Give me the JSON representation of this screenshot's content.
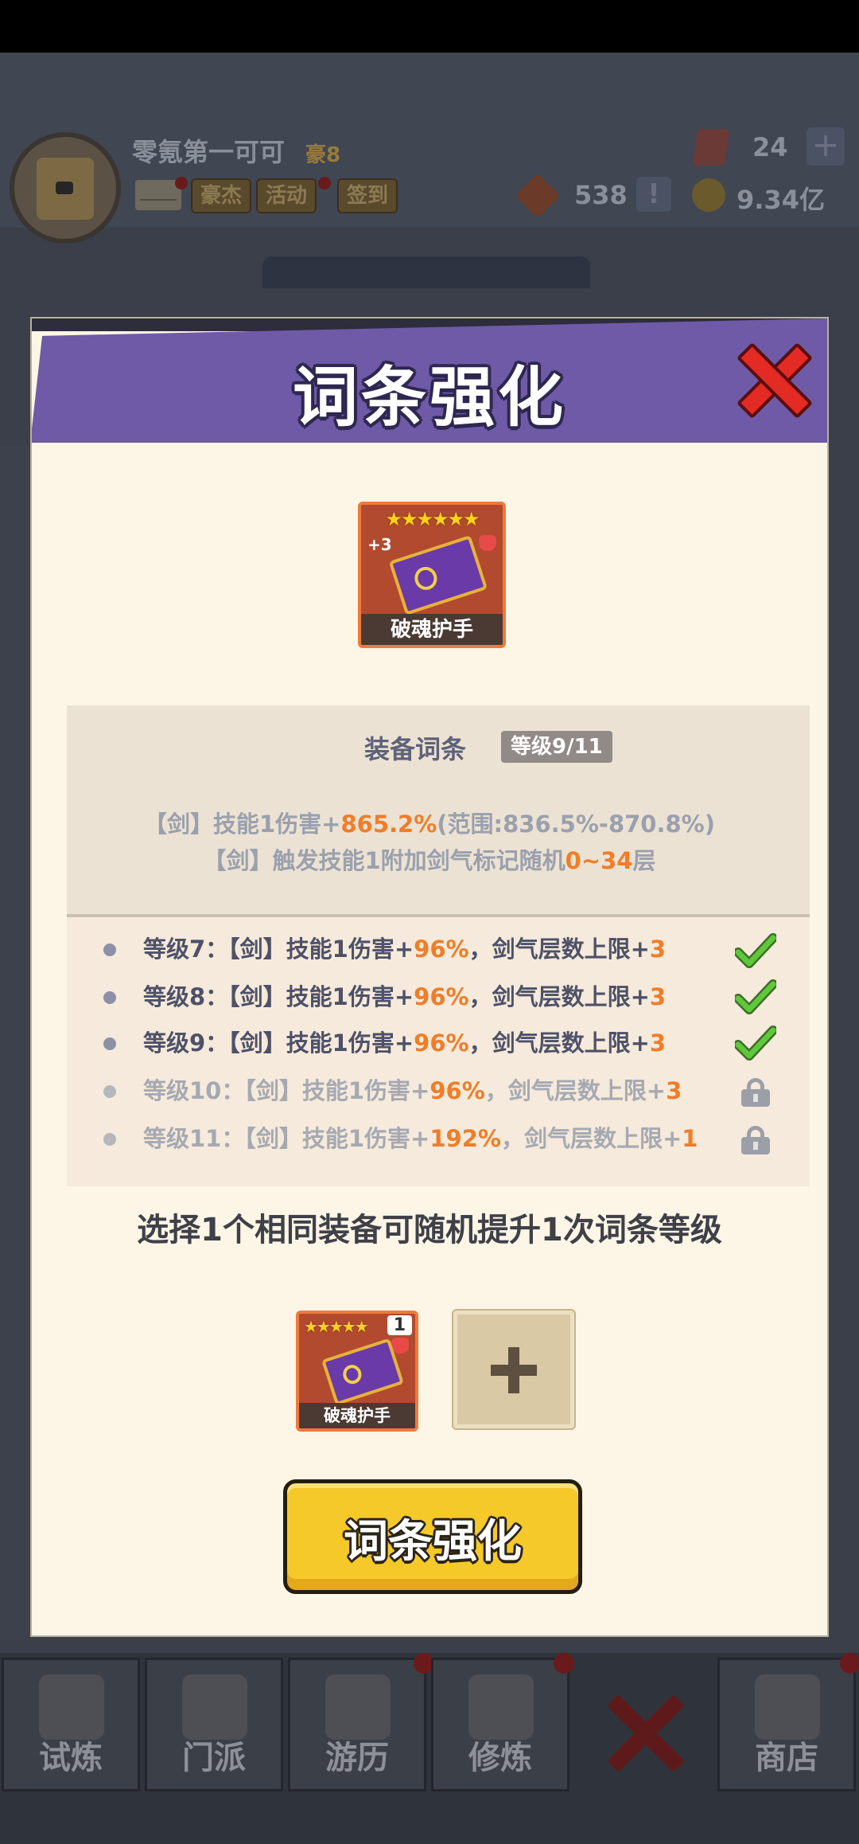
{
  "header": {
    "player_name": "零氪第一可可",
    "rank_label": "豪8",
    "buttons": [
      "豪杰",
      "活动",
      "签到"
    ],
    "gems": "24",
    "tokens": "538",
    "gold": "9.34亿"
  },
  "modal": {
    "title": "词条强化",
    "equipment": {
      "name": "破魂护手",
      "stars": "★★★★★★",
      "plus": "+3"
    },
    "affix_panel": {
      "title": "装备词条",
      "level_badge": "等级9/11",
      "line1_prefix": "【剑】技能1伤害+",
      "line1_value": "865.2%",
      "line1_suffix": "(范围:836.5%-870.8%)",
      "line2_prefix": "【剑】触发技能1附加剑气标记随机",
      "line2_value": "0~34",
      "line2_suffix": "层"
    },
    "levels": [
      {
        "label": "等级7：【剑】技能1伤害+",
        "bonus": "96%",
        "mid": "，剑气层数上限+",
        "cap": "3",
        "unlocked": true
      },
      {
        "label": "等级8：【剑】技能1伤害+",
        "bonus": "96%",
        "mid": "，剑气层数上限+",
        "cap": "3",
        "unlocked": true
      },
      {
        "label": "等级9：【剑】技能1伤害+",
        "bonus": "96%",
        "mid": "，剑气层数上限+",
        "cap": "3",
        "unlocked": true
      },
      {
        "label": "等级10：【剑】技能1伤害+",
        "bonus": "96%",
        "mid": "，剑气层数上限+",
        "cap": "3",
        "unlocked": false
      },
      {
        "label": "等级11：【剑】技能1伤害+",
        "bonus": "192%",
        "mid": "，剑气层数上限+",
        "cap": "1",
        "unlocked": false
      }
    ],
    "hint": "选择1个相同装备可随机提升1次词条等级",
    "material": {
      "name": "破魂护手",
      "stars": "★★★★★",
      "count": "1"
    },
    "action_label": "词条强化"
  },
  "bottom_nav": [
    "试炼",
    "门派",
    "游历",
    "修炼",
    "商店"
  ],
  "colors": {
    "accent": "#6e5aa6",
    "highlight": "#f07d28",
    "button": "#f5c92a",
    "close": "#e32a24"
  }
}
